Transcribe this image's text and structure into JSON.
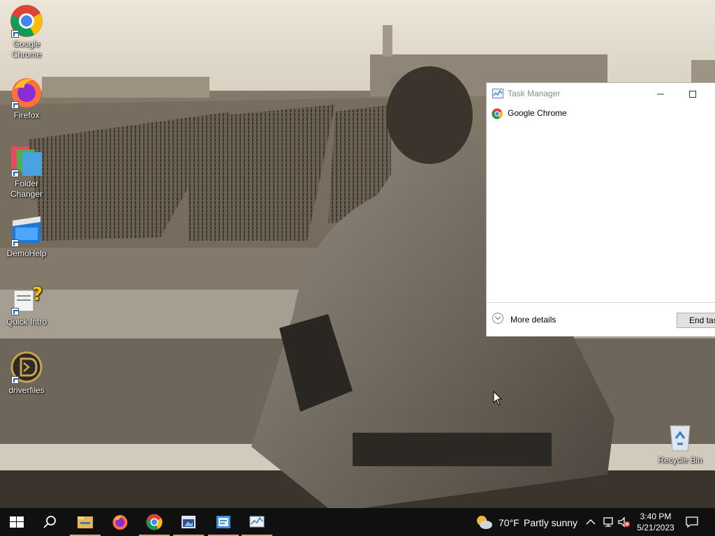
{
  "desktop": {
    "icons": [
      {
        "label": "Google\nChrome",
        "icon": "chrome-icon"
      },
      {
        "label": "Firefox",
        "icon": "firefox-icon"
      },
      {
        "label": "Folder\nChanger",
        "icon": "folder-changer-icon"
      },
      {
        "label": "DemoHelp",
        "icon": "demohelp-icon"
      },
      {
        "label": "Quick Intro",
        "icon": "quick-intro-icon"
      },
      {
        "label": "driverfiles",
        "icon": "driverfiles-icon"
      },
      {
        "label": "Recycle Bin",
        "icon": "recycle-bin-icon"
      }
    ]
  },
  "task_manager": {
    "title": "Task Manager",
    "apps": [
      {
        "name": "Google Chrome",
        "icon": "chrome-icon"
      }
    ],
    "more_details": "More details",
    "end_task": "End task"
  },
  "taskbar": {
    "pinned": [
      "start-icon",
      "search-icon",
      "file-explorer-icon",
      "firefox-icon",
      "chrome-icon",
      "app-icon-1",
      "app-icon-2",
      "task-manager-icon"
    ],
    "weather": {
      "temp": "70°F",
      "condition": "Partly sunny",
      "icon": "partly-sunny-icon"
    },
    "time": "3:40 PM",
    "date": "5/21/2023"
  },
  "colors": {
    "taskbar": "#101010",
    "active_indicator": "#d9a56a"
  }
}
